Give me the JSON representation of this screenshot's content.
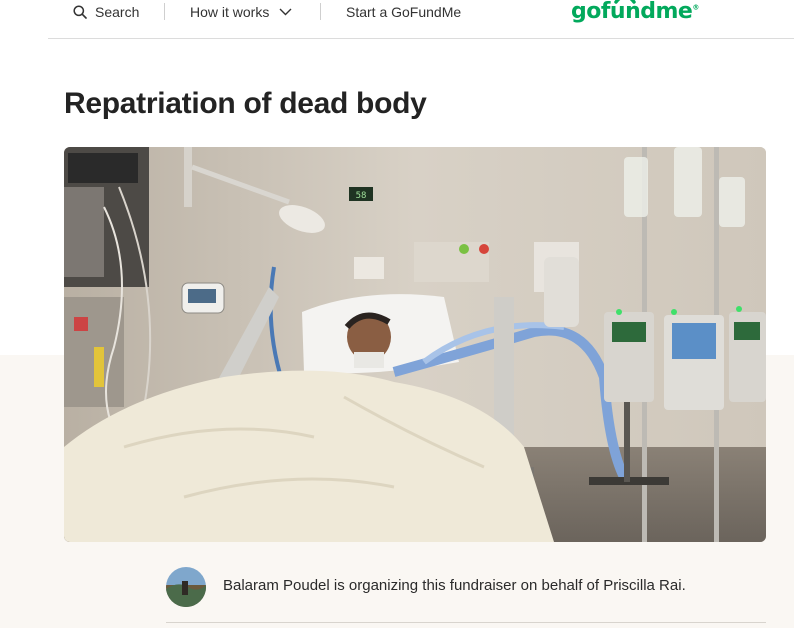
{
  "nav": {
    "search_label": "Search",
    "how_label": "How it works",
    "start_label": "Start a GoFundMe"
  },
  "logo": {
    "text": "gofundme",
    "color": "#02a95c"
  },
  "campaign": {
    "title": "Repatriation of dead body",
    "image_alt": "Patient in hospital bed with medical equipment",
    "monitor_number": "58"
  },
  "organizer": {
    "text": "Balaram Poudel is organizing this fundraiser on behalf of Priscilla Rai."
  },
  "colors": {
    "brand": "#02a95c",
    "beige_bg": "#faf7f3",
    "title": "#232323"
  }
}
